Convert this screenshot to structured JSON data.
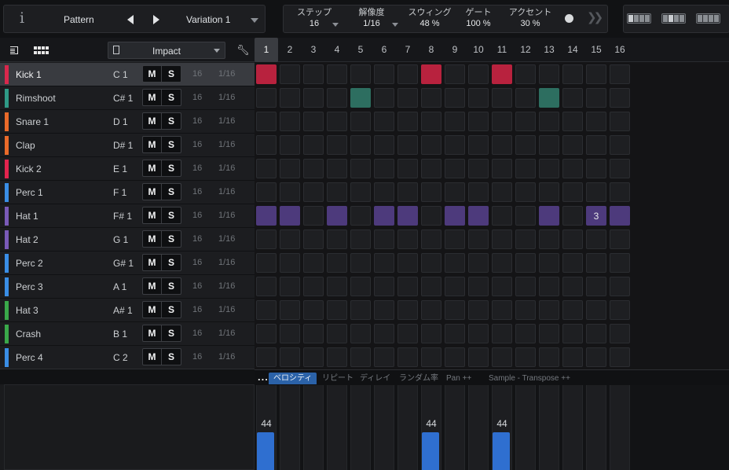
{
  "toolbar": {
    "info_icon": "info-icon",
    "pattern_label": "Pattern",
    "variation_label": "Variation 1",
    "params": [
      {
        "label": "ステップ",
        "value": "16",
        "has_dropdown": true
      },
      {
        "label": "解像度",
        "value": "1/16",
        "has_dropdown": true
      },
      {
        "label": "スウィング",
        "value": "48 %",
        "has_dropdown": false
      },
      {
        "label": "ゲート",
        "value": "100 %",
        "has_dropdown": false
      },
      {
        "label": "アクセント",
        "value": "30 %",
        "has_dropdown": false
      }
    ]
  },
  "kit": {
    "name": "Impact"
  },
  "colors": {
    "kick": "#c0284a",
    "rim": "#2f7a6a",
    "snare": "#e8622a",
    "clap": "#e8622a",
    "kick2": "#e0244e",
    "perc_blue": "#3a8ee0",
    "hat_purple": "#6a4aa8",
    "hat_cell": "#4a3a78",
    "crash_green": "#3aa84a",
    "velocity": "#2f6fd0",
    "accent_tab": "#2b62a8"
  },
  "tracks": [
    {
      "name": "Kick 1",
      "note": "C 1",
      "steps": "16",
      "res": "1/16",
      "color": "#d9284c",
      "selected": true
    },
    {
      "name": "Rimshoot",
      "note": "C# 1",
      "steps": "16",
      "res": "1/16",
      "color": "#2f9a86",
      "selected": false
    },
    {
      "name": "Snare 1",
      "note": "D 1",
      "steps": "16",
      "res": "1/16",
      "color": "#ea6a2a",
      "selected": false
    },
    {
      "name": "Clap",
      "note": "D# 1",
      "steps": "16",
      "res": "1/16",
      "color": "#ea6a2a",
      "selected": false
    },
    {
      "name": "Kick 2",
      "note": "E 1",
      "steps": "16",
      "res": "1/16",
      "color": "#e2244e",
      "selected": false
    },
    {
      "name": "Perc 1",
      "note": "F 1",
      "steps": "16",
      "res": "1/16",
      "color": "#3a8ee6",
      "selected": false
    },
    {
      "name": "Hat 1",
      "note": "F# 1",
      "steps": "16",
      "res": "1/16",
      "color": "#7a5ab8",
      "selected": false
    },
    {
      "name": "Hat 2",
      "note": "G 1",
      "steps": "16",
      "res": "1/16",
      "color": "#7a5ab8",
      "selected": false
    },
    {
      "name": "Perc 2",
      "note": "G# 1",
      "steps": "16",
      "res": "1/16",
      "color": "#3a8ee6",
      "selected": false
    },
    {
      "name": "Perc 3",
      "note": "A 1",
      "steps": "16",
      "res": "1/16",
      "color": "#3a8ee6",
      "selected": false
    },
    {
      "name": "Hat 3",
      "note": "A# 1",
      "steps": "16",
      "res": "1/16",
      "color": "#3aa84a",
      "selected": false
    },
    {
      "name": "Crash",
      "note": "B 1",
      "steps": "16",
      "res": "1/16",
      "color": "#3aa84a",
      "selected": false
    },
    {
      "name": "Perc 4",
      "note": "C 2",
      "steps": "16",
      "res": "1/16",
      "color": "#3a8ee6",
      "selected": false
    }
  ],
  "mute_label": "M",
  "solo_label": "S",
  "step_numbers": [
    "1",
    "2",
    "3",
    "4",
    "5",
    "6",
    "7",
    "8",
    "9",
    "10",
    "11",
    "12",
    "13",
    "14",
    "15",
    "16"
  ],
  "active_step": 1,
  "pattern": {
    "rows": [
      {
        "on": [
          1,
          8,
          11
        ],
        "color": "#b8223e"
      },
      {
        "on": [
          5,
          13
        ],
        "color": "#2d6e60"
      },
      {
        "on": [],
        "color": "#000000"
      },
      {
        "on": [],
        "color": "#000000"
      },
      {
        "on": [],
        "color": "#000000"
      },
      {
        "on": [],
        "color": "#000000"
      },
      {
        "on": [
          1,
          2,
          4,
          6,
          7,
          9,
          10,
          13,
          15,
          16
        ],
        "color": "#4d3a7c",
        "repeat": {
          "15": "3"
        }
      },
      {
        "on": [],
        "color": "#000000"
      },
      {
        "on": [],
        "color": "#000000"
      },
      {
        "on": [],
        "color": "#000000"
      },
      {
        "on": [],
        "color": "#000000"
      },
      {
        "on": [],
        "color": "#000000"
      },
      {
        "on": [],
        "color": "#000000"
      }
    ]
  },
  "editor_tabs": [
    {
      "label": "ベロシティ",
      "active": true
    },
    {
      "label": "リピート",
      "active": false
    },
    {
      "label": "ディレイ",
      "active": false
    },
    {
      "label": "ランダム率",
      "active": false
    },
    {
      "label": "Pan ++",
      "active": false
    },
    {
      "label": "Sample - Transpose ++",
      "active": false
    }
  ],
  "more_label": "...",
  "velocity": [
    {
      "step": 1,
      "value": "44",
      "level": 0.44
    },
    {
      "step": 8,
      "value": "44",
      "level": 0.44
    },
    {
      "step": 11,
      "value": "44",
      "level": 0.44
    }
  ]
}
